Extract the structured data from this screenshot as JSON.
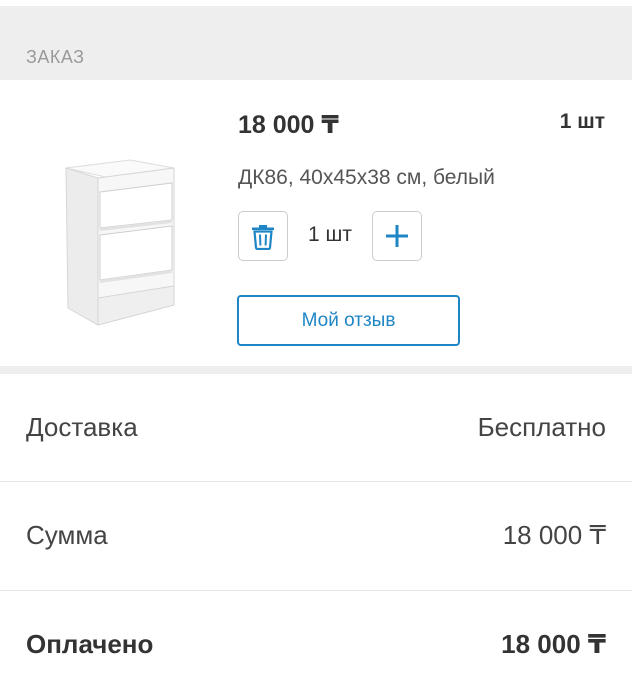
{
  "section": {
    "title": "ЗАКАЗ"
  },
  "item": {
    "image_icon": "nightstand-image",
    "price": "18 000 ₸",
    "quantity_label": "1 шт",
    "description": "ДК86, 40x45x38 см, белый",
    "stepper": {
      "value": "1 шт",
      "delete_icon": "trash-icon",
      "add_icon": "plus-icon"
    },
    "review_button": "Мой отзыв"
  },
  "summary": {
    "delivery_label": "Доставка",
    "delivery_value": "Бесплатно",
    "sum_label": "Сумма",
    "sum_value": "18 000 ₸",
    "paid_label": "Оплачено",
    "paid_value": "18 000 ₸"
  },
  "colors": {
    "accent": "#1f86c6",
    "band": "#eeeeee",
    "text": "#333333"
  }
}
